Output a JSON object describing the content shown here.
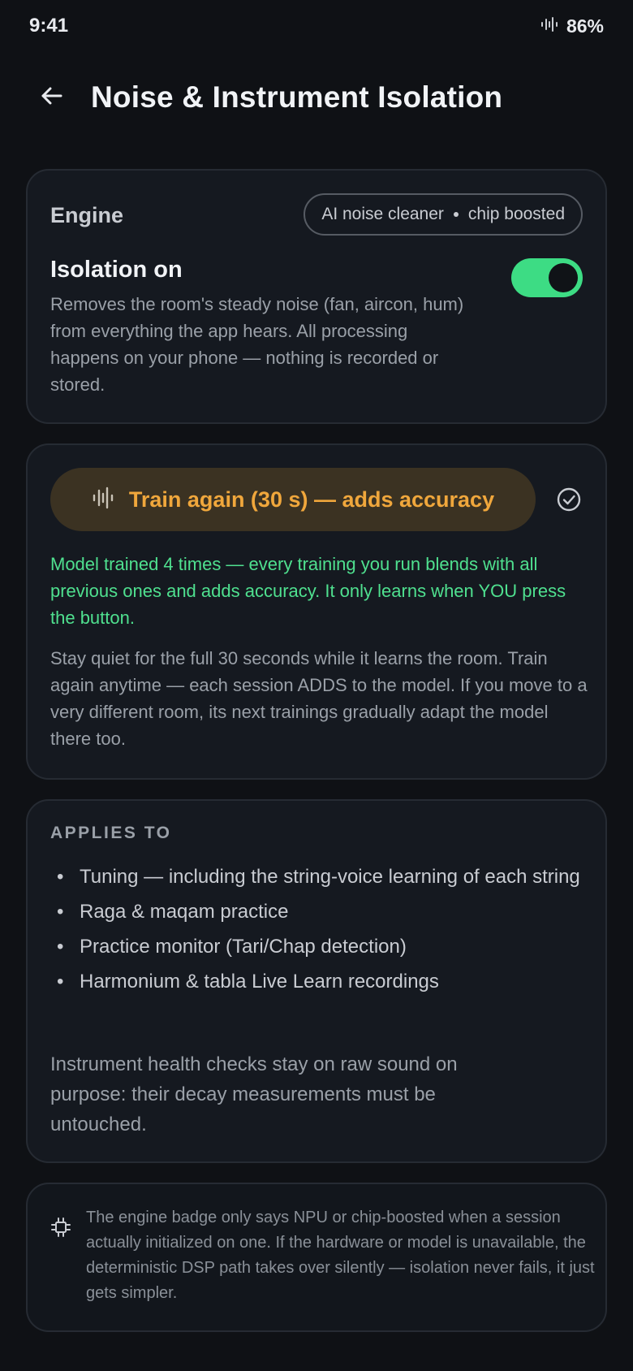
{
  "status_bar": {
    "time": "9:41",
    "battery": "86%",
    "waveform_icon": "waveform-icon"
  },
  "header": {
    "title": "Noise & Instrument Isolation",
    "back_icon": "arrow-left-icon"
  },
  "engine": {
    "label": "Engine",
    "chip_left": "AI noise cleaner",
    "chip_right": "chip boosted",
    "isolation_title": "Isolation on",
    "isolation_desc": "Removes the room's steady noise (fan, aircon, hum) from everything the app hears. All processing happens on your phone — nothing is recorded or stored.",
    "toggle_on": true
  },
  "training": {
    "button_label": "Train again (30 s) — adds accuracy",
    "button_icon": "waveform-icon",
    "done_icon": "check-circle-icon",
    "status": "Model trained 4 times — every training you run blends with all previous ones and adds accuracy. It only learns when YOU press the button.",
    "help": "Stay quiet for the full 30 seconds while it learns the room. Train again anytime — each session ADDS to the model. If you move to a very different room, its next trainings gradually adapt the model there too."
  },
  "applies": {
    "heading": "APPLIES TO",
    "items": [
      "Tuning — including the string-voice learning of each string",
      "Raga & maqam practice",
      "Practice monitor (Tari/Chap detection)",
      "Harmonium & tabla Live Learn recordings"
    ],
    "footnote": "Instrument health checks stay on raw sound on purpose: their decay measurements must be untouched."
  },
  "note": {
    "icon": "chip-icon",
    "text": "The engine badge only says NPU or chip-boosted when a session actually initialized on one. If the hardware or model is unavailable, the deterministic DSP path takes over silently — isolation never fails, it just gets simpler."
  },
  "colors": {
    "background": "#0f1115",
    "card": "#151920",
    "accent_green": "#3ddc84",
    "accent_orange": "#f0a73c",
    "status_green": "#4fe08f"
  }
}
